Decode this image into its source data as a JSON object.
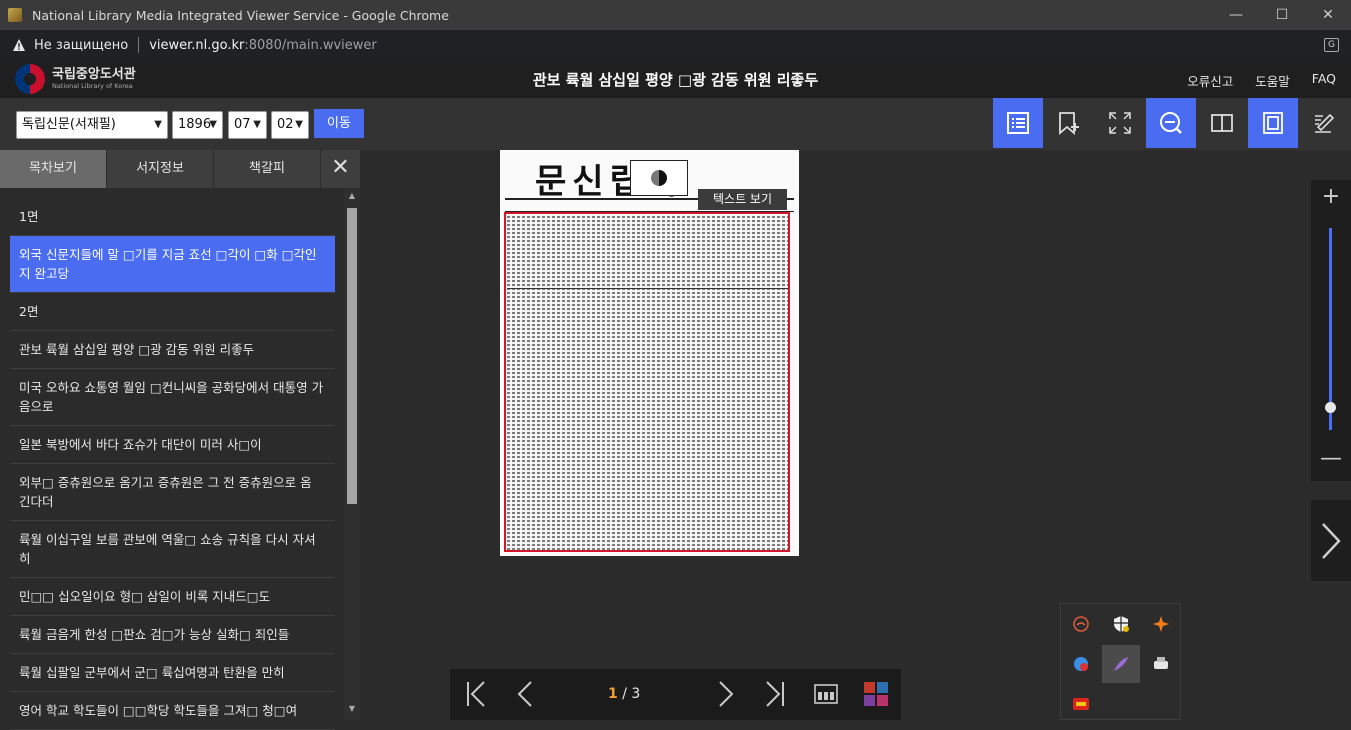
{
  "browser": {
    "window_title": "National Library Media Integrated Viewer Service - Google Chrome",
    "security_text": "Не защищено",
    "url_host": "viewer.nl.go.kr",
    "url_rest": ":8080/main.wviewer"
  },
  "header": {
    "logo_ko": "국립중앙도서관",
    "logo_en": "National Library of Korea",
    "title": "관보 륙월 삼십일 평양 □광 감동 위원 리좋두",
    "links": [
      "오류신고",
      "도움말",
      "FAQ"
    ]
  },
  "toolbar": {
    "newspaper": "독립신문(서재필)",
    "year": "1896",
    "month": "07",
    "day": "02",
    "go_label": "이동"
  },
  "panel": {
    "tabs": [
      "목차보기",
      "서지정보",
      "책갈피"
    ],
    "close_icon": "close-icon"
  },
  "toc": [
    {
      "text": "1면",
      "type": "section"
    },
    {
      "text": "외국 신문지들에 말 □기를 지금 죠선 □각이 □화 □각인지 완고당",
      "type": "article",
      "selected": true
    },
    {
      "text": "2면",
      "type": "section"
    },
    {
      "text": "관보 륙월 삼십일 평양 □광 감동 위원 리좋두",
      "type": "article"
    },
    {
      "text": "미국 오하요 쇼통영 월임 □컨니씨을 공화당에서 대통영 가음으로",
      "type": "article"
    },
    {
      "text": "일본 북방에서 바다 죠슈가 대단이 미러 사□이",
      "type": "article"
    },
    {
      "text": "외부□ 증츄원으로 옴기고 증츄원은 그 전 증츄원으로 옴 긴다더",
      "type": "article"
    },
    {
      "text": "륙월 이십구일 보름 관보에 역울□ 쇼송 규칙을 다시 자셔히",
      "type": "article"
    },
    {
      "text": "민□□ 십오일이요 형□ 삼일이 비록 지내드□도",
      "type": "article"
    },
    {
      "text": "륙월 금음게 한성 □판쇼 검□가 능상 실화□ 죄인들",
      "type": "article"
    },
    {
      "text": "륙월 십팔일 군부에서 군□ 륙십여명과 탄환을 만히",
      "type": "article"
    },
    {
      "text": "영어 학교 학도들이 □□학당 학도들을 그져□ 청□여",
      "type": "article"
    }
  ],
  "newspaper": {
    "masthead": "문신립독",
    "tooltip": "텍스트 보기"
  },
  "pager": {
    "current": "1",
    "total": "/ 3"
  },
  "colors": {
    "accent": "#4a6cf0",
    "highlight_frame": "#d0182a"
  }
}
